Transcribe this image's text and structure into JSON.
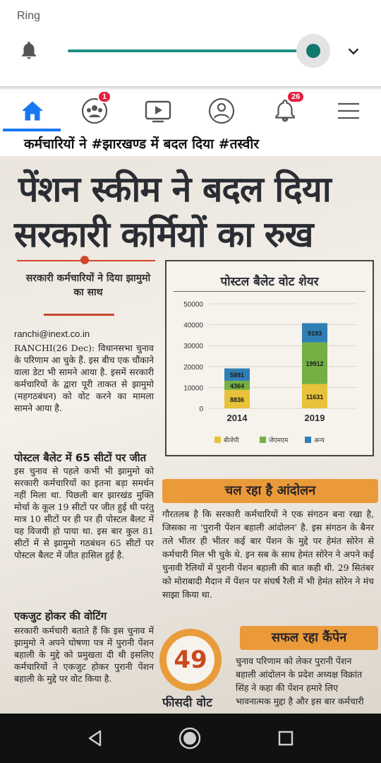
{
  "status": {
    "ring_label": "Ring",
    "volume_level": 0.95
  },
  "nav": {
    "tabs": [
      {
        "name": "home",
        "icon": "home-icon",
        "active": true
      },
      {
        "name": "friends",
        "icon": "friends-icon",
        "badge": "1"
      },
      {
        "name": "watch",
        "icon": "video-icon"
      },
      {
        "name": "profile",
        "icon": "profile-icon"
      },
      {
        "name": "notifications",
        "icon": "bell-icon",
        "badge": "26"
      },
      {
        "name": "menu",
        "icon": "menu-icon"
      }
    ]
  },
  "post": {
    "caption": "कर्मचारियों ने #झारखण्ड में बदल दिया #तस्वीर"
  },
  "article": {
    "headline_line1": "पेंशन स्कीम ने बदल दिया",
    "headline_line2": "सरकारी कर्मियों का रुख",
    "subhead": "सरकारी कर्मचारियों ने दिया झामुमो का साथ",
    "email": "ranchi@inext.co.in",
    "para1": "RANCHI(26 Dec): विधानसभा चुनाव के परिणाम आ चुके हैं. इस बीच एक चौंकाने वाला डेटा भी सामने आया है. इसमें सरकारी कर्मचारियों के द्वारा पूरी ताकत से झामुमो (महगठबंधन) को वोट करने का मामला सामने आया है.",
    "section1": "पोस्टल बैलेट में 65 सीटों पर जीत",
    "para2": "इस चुनाव से पहले कभी भी झामुमो को सरकारी कर्मचारियों का इतना बड़ा समर्थन नहीं मिला था. पिछली बार झारखंड मुक्ति मोर्चा के कूल 19 सीटों पर जीत हुई थी परंतु मात्र 10 सीटों पर ही पर ही पोस्टल बैलट में यह विजयी हो पाया था. इस बार कुल 81 सीटों में से झामुमो गठबंधन 65 सीटों पर पोस्टल बैलट में जीत हासिल हुई है.",
    "section2": "एकजुट होकर की वोटिंग",
    "para3": "सरकारी कर्मचारी बताते हैं कि इस चुनाव में झामुमो ने अपने घोषणा पत्र में पुरानी पेंशन बहाली के मुद्दे को प्रमुखता दी थी इसलिए कर्मचारियों ने एकजुट होकर पुरानी पेंशन बहाली के मुद्दे पर वोट किया है.",
    "band1": "चल रहा है आंदोलन",
    "right_para": "गौरतलब है कि सरकारी कर्मचारियों ने एक संगठन बना रखा है, जिसका ना 'पुरानी पेंशन बहाली आंदोलन' है. इस संगठन के बैनर तले भीतर ही भीतर कई बार पेंशन के मुद्दे पर हेमंत सोरेन से कर्मचारी मिल भी चुके थे. इन सब के साथ हेमंत सोरेन ने अपने कई चुनावी रैलियों में पुरानी पेंशन बहाली की बात कही थी. 29 सितंबर को मोराबादी मैदान में पेंशन पर संघर्ष रैली में भी हेमंत सोरेन ने मंच साझा किया था.",
    "band2": "सफल रहा कैंपेन",
    "right_para2": "चुनाव परिणाम को लेकर पुरानी पेंशन बहाली आंदोलन के प्रदेश अध्यक्ष विक्रांत सिंह ने कहा की पेंशन हमारे लिए भावनात्मक मुद्दा है और इस बार कर्मचारी",
    "stat_number": "49",
    "stat_label": "फीसदी वोट"
  },
  "chart_data": {
    "type": "bar",
    "stacked": true,
    "title": "पोस्टल बैलेट वोट शेयर",
    "categories": [
      "2014",
      "2019"
    ],
    "series": [
      {
        "name": "बीजेपी",
        "values": [
          8836,
          11631
        ],
        "color": "#e8c23a"
      },
      {
        "name": "जेएमएम",
        "values": [
          4364,
          19912
        ],
        "color": "#74b043"
      },
      {
        "name": "अन्य",
        "values": [
          5891,
          9193
        ],
        "color": "#2f7fb5"
      }
    ],
    "y_ticks": [
      "0",
      "10000",
      "20000",
      "30000",
      "40000",
      "50000"
    ],
    "ylim": [
      0,
      50000
    ],
    "legend_position": "bottom"
  }
}
